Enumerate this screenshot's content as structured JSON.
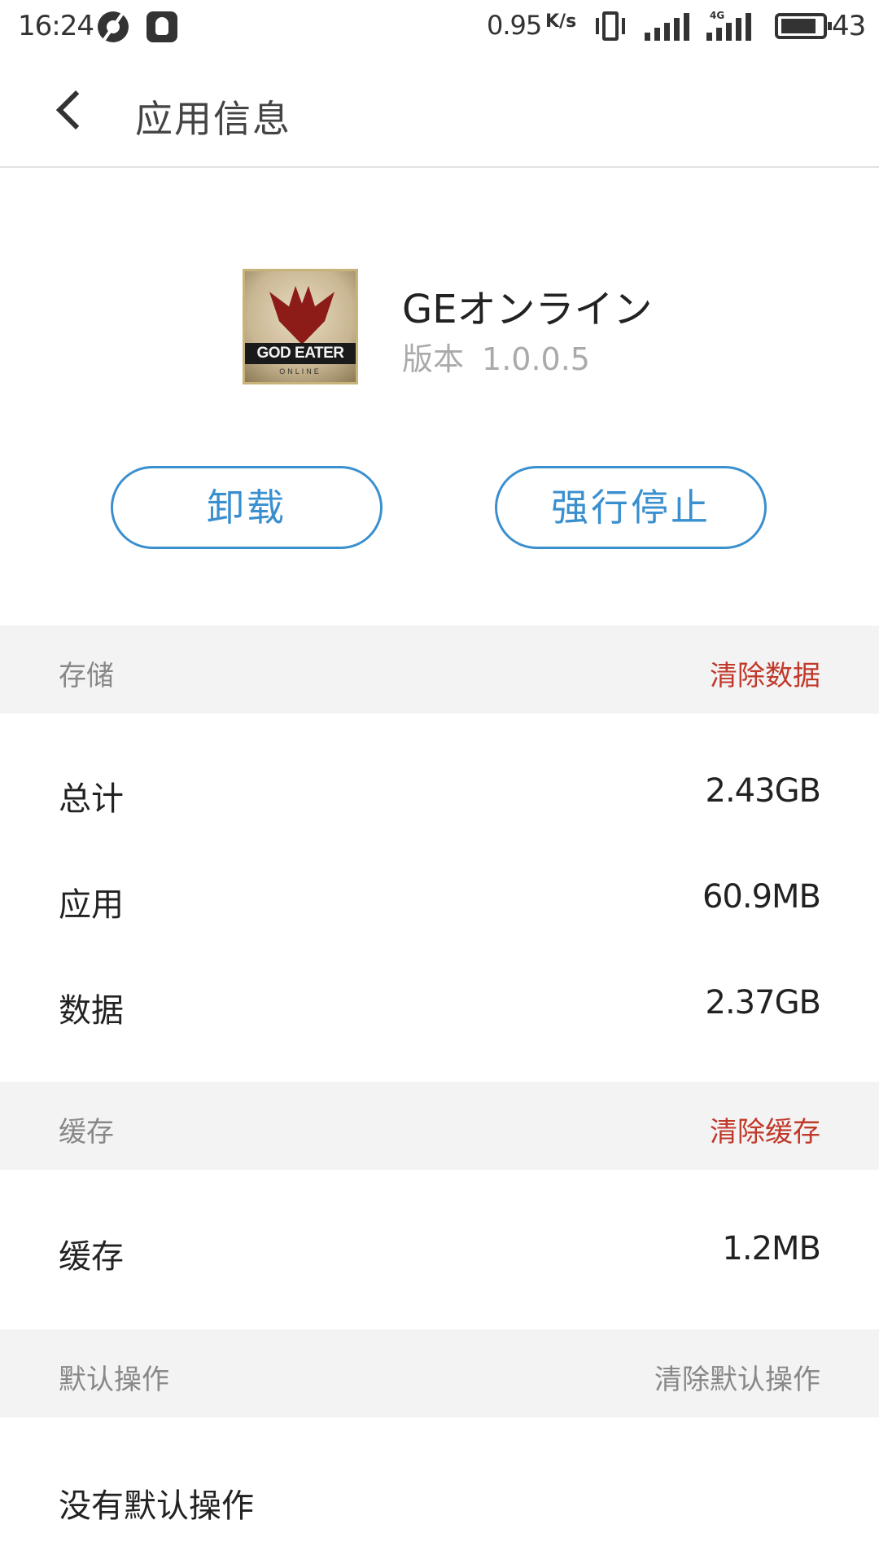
{
  "status_bar": {
    "time": "16:24",
    "net_speed": "0.95",
    "net_unit": "K/s",
    "network_type": "4G",
    "battery": "43",
    "icons": [
      "aperture-icon",
      "qq-icon",
      "vibrate-icon",
      "signal-icon",
      "signal-4g-icon",
      "battery-icon"
    ]
  },
  "title_bar": {
    "title": "应用信息"
  },
  "app": {
    "name": "GEオンライン",
    "version_label": "版本",
    "version": "1.0.0.5",
    "icon_text": "GOD EATER",
    "icon_subtext": "ONLINE"
  },
  "actions": {
    "uninstall": "卸载",
    "force_stop": "强行停止"
  },
  "storage": {
    "header": "存储",
    "clear": "清除数据",
    "rows": [
      {
        "label": "总计",
        "value": "2.43GB"
      },
      {
        "label": "应用",
        "value": "60.9MB"
      },
      {
        "label": "数据",
        "value": "2.37GB"
      }
    ]
  },
  "cache": {
    "header": "缓存",
    "clear": "清除缓存",
    "rows": [
      {
        "label": "缓存",
        "value": "1.2MB"
      }
    ]
  },
  "defaults": {
    "header": "默认操作",
    "clear": "清除默认操作",
    "text": "没有默认操作"
  },
  "colors": {
    "accent": "#3a8fcf",
    "danger": "#c0392b",
    "section_bg": "#f3f3f3"
  }
}
